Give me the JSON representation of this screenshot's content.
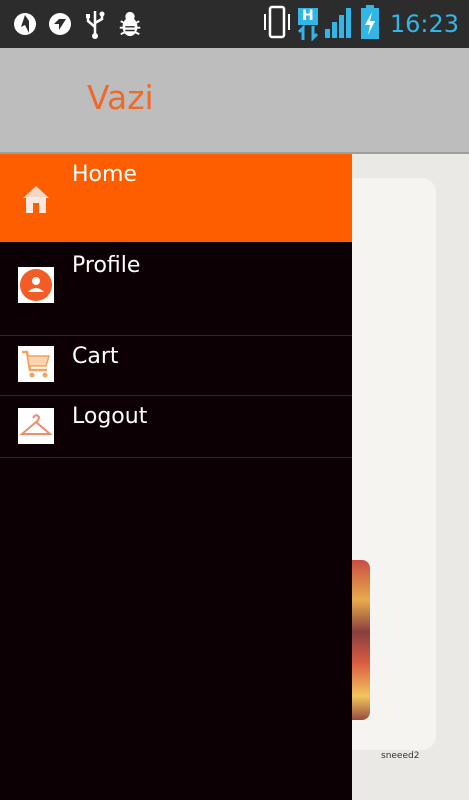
{
  "status_bar": {
    "time": "16:23",
    "network_type": "H",
    "icons": [
      "vpn-icon",
      "app-icon",
      "usb-icon",
      "debug-icon",
      "vibrate-icon",
      "data-transfer-icon",
      "signal-icon",
      "battery-charging-icon"
    ]
  },
  "app_bar": {
    "title": "Vazi"
  },
  "drawer": {
    "items": [
      {
        "label": "Home",
        "icon": "home-icon",
        "active": true
      },
      {
        "label": "Profile",
        "icon": "profile-icon",
        "active": false
      },
      {
        "label": "Cart",
        "icon": "cart-icon",
        "active": false
      },
      {
        "label": "Logout",
        "icon": "hanger-icon",
        "active": false
      }
    ]
  },
  "background": {
    "photo_credit": "sneeed2"
  },
  "colors": {
    "accent": "#ff5e00",
    "title": "#ee6a2a",
    "drawer_bg": "#0d0004",
    "app_bar_bg": "#bdbdbd",
    "status_time": "#33b5e5"
  }
}
